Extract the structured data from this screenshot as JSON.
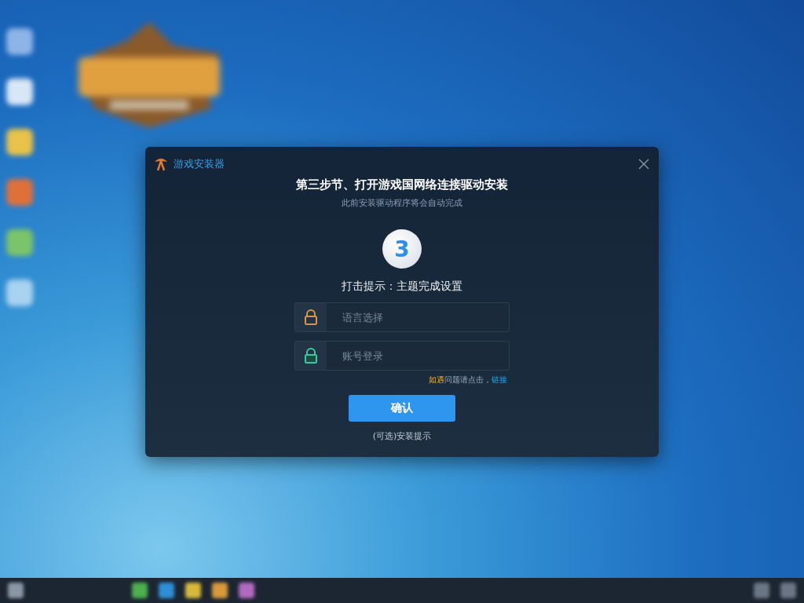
{
  "dialog": {
    "title": "游戏安装器",
    "heading": "第三步节、打开游戏国网络连接驱动安装",
    "subtitle": "此前安装驱动程序将会自动完成",
    "step": "3",
    "hint": "打击提示：主题完成设置",
    "fields": [
      {
        "kind": "language",
        "placeholder": "语言选择"
      },
      {
        "kind": "account",
        "placeholder": "账号登录"
      }
    ],
    "help": {
      "tag": "如遇",
      "text": "问题请点击，",
      "link": "链接"
    },
    "confirm": "确认",
    "footer": "(可选)安装提示"
  }
}
